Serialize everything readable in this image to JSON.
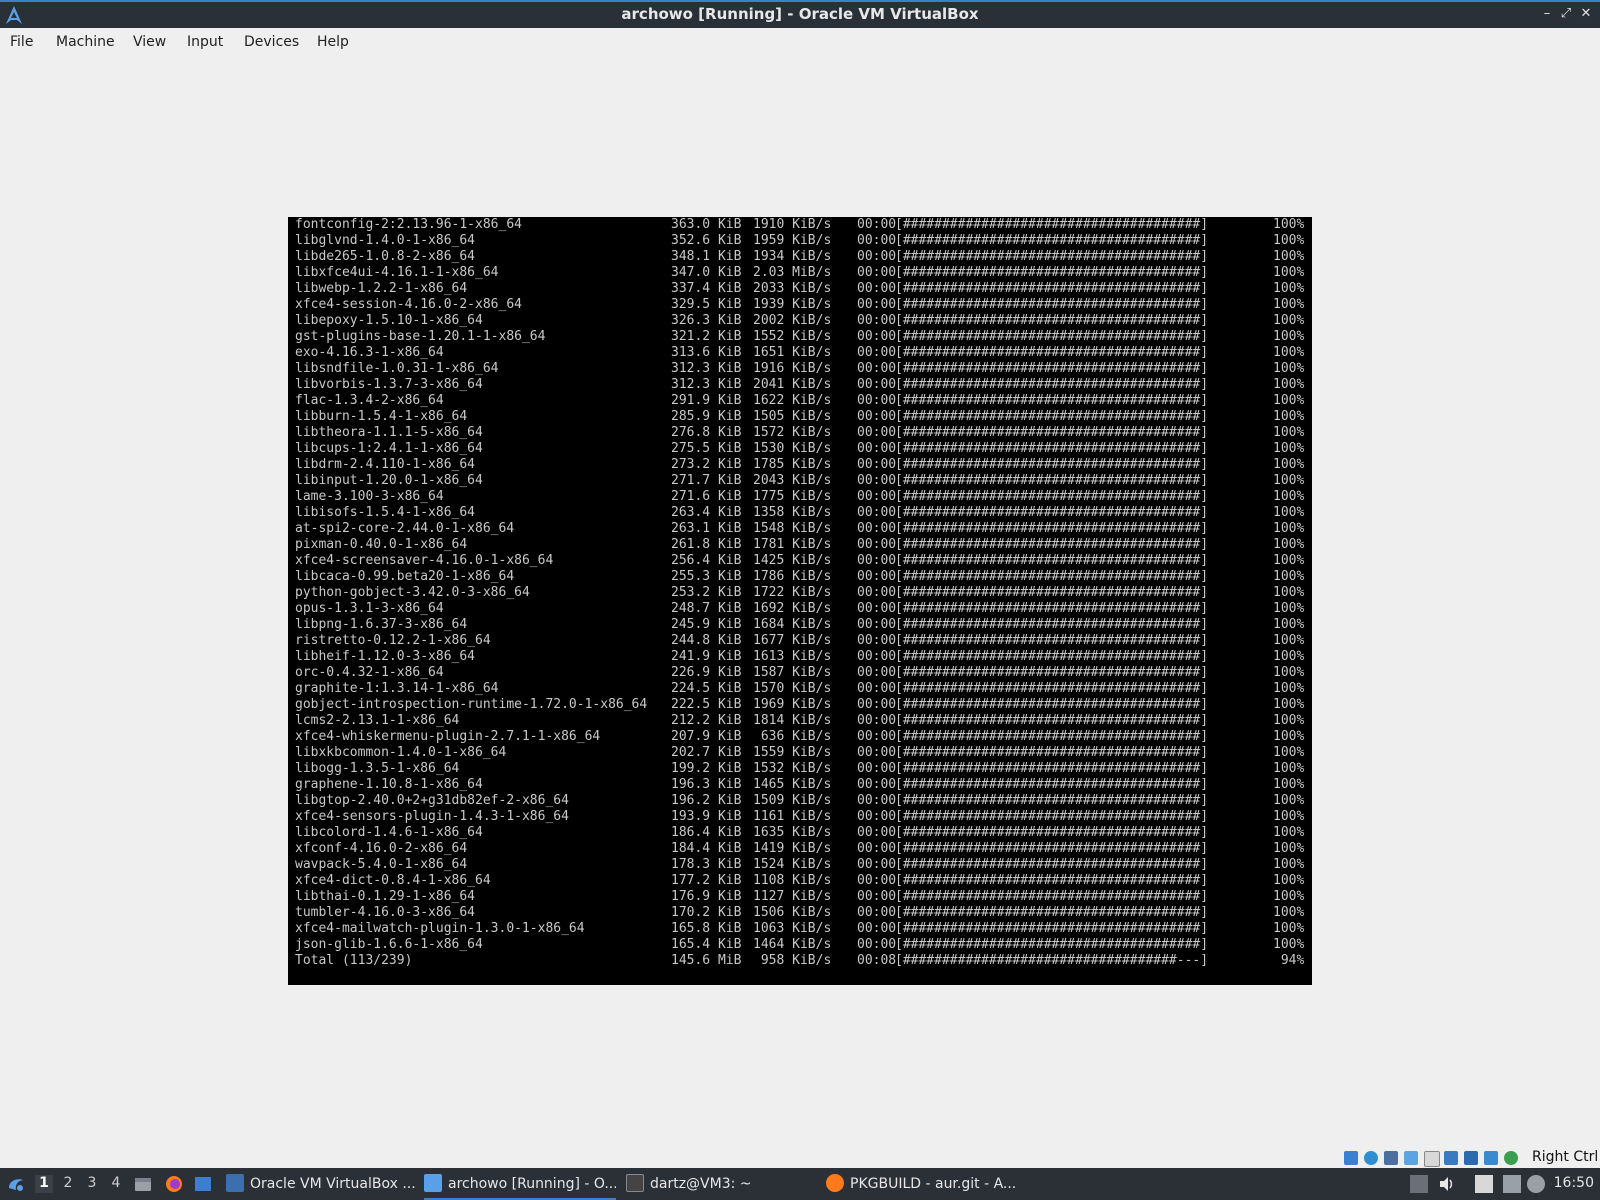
{
  "window": {
    "title": "archowo [Running] - Oracle VM VirtualBox",
    "controls": {
      "minimize": "–",
      "maximize": "⤢",
      "close": "✕"
    }
  },
  "menu": [
    "File",
    "Machine",
    "View",
    "Input",
    "Devices",
    "Help"
  ],
  "terminal": {
    "rows": [
      {
        "name": "fontconfig-2:2.13.96-1-x86_64",
        "size": "363.0 KiB",
        "rate": "1910 KiB/s",
        "time": "00:00",
        "bar": "[######################################]",
        "pct": "100%"
      },
      {
        "name": "libglvnd-1.4.0-1-x86_64",
        "size": "352.6 KiB",
        "rate": "1959 KiB/s",
        "time": "00:00",
        "bar": "[######################################]",
        "pct": "100%"
      },
      {
        "name": "libde265-1.0.8-2-x86_64",
        "size": "348.1 KiB",
        "rate": "1934 KiB/s",
        "time": "00:00",
        "bar": "[######################################]",
        "pct": "100%"
      },
      {
        "name": "libxfce4ui-4.16.1-1-x86_64",
        "size": "347.0 KiB",
        "rate": "2.03 MiB/s",
        "time": "00:00",
        "bar": "[######################################]",
        "pct": "100%"
      },
      {
        "name": "libwebp-1.2.2-1-x86_64",
        "size": "337.4 KiB",
        "rate": "2033 KiB/s",
        "time": "00:00",
        "bar": "[######################################]",
        "pct": "100%"
      },
      {
        "name": "xfce4-session-4.16.0-2-x86_64",
        "size": "329.5 KiB",
        "rate": "1939 KiB/s",
        "time": "00:00",
        "bar": "[######################################]",
        "pct": "100%"
      },
      {
        "name": "libepoxy-1.5.10-1-x86_64",
        "size": "326.3 KiB",
        "rate": "2002 KiB/s",
        "time": "00:00",
        "bar": "[######################################]",
        "pct": "100%"
      },
      {
        "name": "gst-plugins-base-1.20.1-1-x86_64",
        "size": "321.2 KiB",
        "rate": "1552 KiB/s",
        "time": "00:00",
        "bar": "[######################################]",
        "pct": "100%"
      },
      {
        "name": "exo-4.16.3-1-x86_64",
        "size": "313.6 KiB",
        "rate": "1651 KiB/s",
        "time": "00:00",
        "bar": "[######################################]",
        "pct": "100%"
      },
      {
        "name": "libsndfile-1.0.31-1-x86_64",
        "size": "312.3 KiB",
        "rate": "1916 KiB/s",
        "time": "00:00",
        "bar": "[######################################]",
        "pct": "100%"
      },
      {
        "name": "libvorbis-1.3.7-3-x86_64",
        "size": "312.3 KiB",
        "rate": "2041 KiB/s",
        "time": "00:00",
        "bar": "[######################################]",
        "pct": "100%"
      },
      {
        "name": "flac-1.3.4-2-x86_64",
        "size": "291.9 KiB",
        "rate": "1622 KiB/s",
        "time": "00:00",
        "bar": "[######################################]",
        "pct": "100%"
      },
      {
        "name": "libburn-1.5.4-1-x86_64",
        "size": "285.9 KiB",
        "rate": "1505 KiB/s",
        "time": "00:00",
        "bar": "[######################################]",
        "pct": "100%"
      },
      {
        "name": "libtheora-1.1.1-5-x86_64",
        "size": "276.8 KiB",
        "rate": "1572 KiB/s",
        "time": "00:00",
        "bar": "[######################################]",
        "pct": "100%"
      },
      {
        "name": "libcups-1:2.4.1-1-x86_64",
        "size": "275.5 KiB",
        "rate": "1530 KiB/s",
        "time": "00:00",
        "bar": "[######################################]",
        "pct": "100%"
      },
      {
        "name": "libdrm-2.4.110-1-x86_64",
        "size": "273.2 KiB",
        "rate": "1785 KiB/s",
        "time": "00:00",
        "bar": "[######################################]",
        "pct": "100%"
      },
      {
        "name": "libinput-1.20.0-1-x86_64",
        "size": "271.7 KiB",
        "rate": "2043 KiB/s",
        "time": "00:00",
        "bar": "[######################################]",
        "pct": "100%"
      },
      {
        "name": "lame-3.100-3-x86_64",
        "size": "271.6 KiB",
        "rate": "1775 KiB/s",
        "time": "00:00",
        "bar": "[######################################]",
        "pct": "100%"
      },
      {
        "name": "libisofs-1.5.4-1-x86_64",
        "size": "263.4 KiB",
        "rate": "1358 KiB/s",
        "time": "00:00",
        "bar": "[######################################]",
        "pct": "100%"
      },
      {
        "name": "at-spi2-core-2.44.0-1-x86_64",
        "size": "263.1 KiB",
        "rate": "1548 KiB/s",
        "time": "00:00",
        "bar": "[######################################]",
        "pct": "100%"
      },
      {
        "name": "pixman-0.40.0-1-x86_64",
        "size": "261.8 KiB",
        "rate": "1781 KiB/s",
        "time": "00:00",
        "bar": "[######################################]",
        "pct": "100%"
      },
      {
        "name": "xfce4-screensaver-4.16.0-1-x86_64",
        "size": "256.4 KiB",
        "rate": "1425 KiB/s",
        "time": "00:00",
        "bar": "[######################################]",
        "pct": "100%"
      },
      {
        "name": "libcaca-0.99.beta20-1-x86_64",
        "size": "255.3 KiB",
        "rate": "1786 KiB/s",
        "time": "00:00",
        "bar": "[######################################]",
        "pct": "100%"
      },
      {
        "name": "python-gobject-3.42.0-3-x86_64",
        "size": "253.2 KiB",
        "rate": "1722 KiB/s",
        "time": "00:00",
        "bar": "[######################################]",
        "pct": "100%"
      },
      {
        "name": "opus-1.3.1-3-x86_64",
        "size": "248.7 KiB",
        "rate": "1692 KiB/s",
        "time": "00:00",
        "bar": "[######################################]",
        "pct": "100%"
      },
      {
        "name": "libpng-1.6.37-3-x86_64",
        "size": "245.9 KiB",
        "rate": "1684 KiB/s",
        "time": "00:00",
        "bar": "[######################################]",
        "pct": "100%"
      },
      {
        "name": "ristretto-0.12.2-1-x86_64",
        "size": "244.8 KiB",
        "rate": "1677 KiB/s",
        "time": "00:00",
        "bar": "[######################################]",
        "pct": "100%"
      },
      {
        "name": "libheif-1.12.0-3-x86_64",
        "size": "241.9 KiB",
        "rate": "1613 KiB/s",
        "time": "00:00",
        "bar": "[######################################]",
        "pct": "100%"
      },
      {
        "name": "orc-0.4.32-1-x86_64",
        "size": "226.9 KiB",
        "rate": "1587 KiB/s",
        "time": "00:00",
        "bar": "[######################################]",
        "pct": "100%"
      },
      {
        "name": "graphite-1:1.3.14-1-x86_64",
        "size": "224.5 KiB",
        "rate": "1570 KiB/s",
        "time": "00:00",
        "bar": "[######################################]",
        "pct": "100%"
      },
      {
        "name": "gobject-introspection-runtime-1.72.0-1-x86_64",
        "size": "222.5 KiB",
        "rate": "1969 KiB/s",
        "time": "00:00",
        "bar": "[######################################]",
        "pct": "100%"
      },
      {
        "name": "lcms2-2.13.1-1-x86_64",
        "size": "212.2 KiB",
        "rate": "1814 KiB/s",
        "time": "00:00",
        "bar": "[######################################]",
        "pct": "100%"
      },
      {
        "name": "xfce4-whiskermenu-plugin-2.7.1-1-x86_64",
        "size": "207.9 KiB",
        "rate": " 636 KiB/s",
        "time": "00:00",
        "bar": "[######################################]",
        "pct": "100%"
      },
      {
        "name": "libxkbcommon-1.4.0-1-x86_64",
        "size": "202.7 KiB",
        "rate": "1559 KiB/s",
        "time": "00:00",
        "bar": "[######################################]",
        "pct": "100%"
      },
      {
        "name": "libogg-1.3.5-1-x86_64",
        "size": "199.2 KiB",
        "rate": "1532 KiB/s",
        "time": "00:00",
        "bar": "[######################################]",
        "pct": "100%"
      },
      {
        "name": "graphene-1.10.8-1-x86_64",
        "size": "196.3 KiB",
        "rate": "1465 KiB/s",
        "time": "00:00",
        "bar": "[######################################]",
        "pct": "100%"
      },
      {
        "name": "libgtop-2.40.0+2+g31db82ef-2-x86_64",
        "size": "196.2 KiB",
        "rate": "1509 KiB/s",
        "time": "00:00",
        "bar": "[######################################]",
        "pct": "100%"
      },
      {
        "name": "xfce4-sensors-plugin-1.4.3-1-x86_64",
        "size": "193.9 KiB",
        "rate": "1161 KiB/s",
        "time": "00:00",
        "bar": "[######################################]",
        "pct": "100%"
      },
      {
        "name": "libcolord-1.4.6-1-x86_64",
        "size": "186.4 KiB",
        "rate": "1635 KiB/s",
        "time": "00:00",
        "bar": "[######################################]",
        "pct": "100%"
      },
      {
        "name": "xfconf-4.16.0-2-x86_64",
        "size": "184.4 KiB",
        "rate": "1419 KiB/s",
        "time": "00:00",
        "bar": "[######################################]",
        "pct": "100%"
      },
      {
        "name": "wavpack-5.4.0-1-x86_64",
        "size": "178.3 KiB",
        "rate": "1524 KiB/s",
        "time": "00:00",
        "bar": "[######################################]",
        "pct": "100%"
      },
      {
        "name": "xfce4-dict-0.8.4-1-x86_64",
        "size": "177.2 KiB",
        "rate": "1108 KiB/s",
        "time": "00:00",
        "bar": "[######################################]",
        "pct": "100%"
      },
      {
        "name": "libthai-0.1.29-1-x86_64",
        "size": "176.9 KiB",
        "rate": "1127 KiB/s",
        "time": "00:00",
        "bar": "[######################################]",
        "pct": "100%"
      },
      {
        "name": "tumbler-4.16.0-3-x86_64",
        "size": "170.2 KiB",
        "rate": "1506 KiB/s",
        "time": "00:00",
        "bar": "[######################################]",
        "pct": "100%"
      },
      {
        "name": "xfce4-mailwatch-plugin-1.3.0-1-x86_64",
        "size": "165.8 KiB",
        "rate": "1063 KiB/s",
        "time": "00:00",
        "bar": "[######################################]",
        "pct": "100%"
      },
      {
        "name": "json-glib-1.6.6-1-x86_64",
        "size": "165.4 KiB",
        "rate": "1464 KiB/s",
        "time": "00:00",
        "bar": "[######################################]",
        "pct": "100%"
      },
      {
        "name": "Total (113/239)",
        "size": "145.6 MiB",
        "rate": " 958 KiB/s",
        "time": "00:08",
        "bar": "[###################################---]",
        "pct": " 94%"
      }
    ]
  },
  "statusbar": {
    "icons": [
      "hard-disk-icon",
      "optical-disk-icon",
      "network-icon",
      "usb-icon",
      "shared-folder-icon",
      "display-icon",
      "video-capture-icon",
      "recording-icon",
      "mouse-integration-icon",
      "cpu-icon"
    ],
    "host_key": "Right Ctrl"
  },
  "taskbar": {
    "workspaces": [
      "1",
      "2",
      "3",
      "4"
    ],
    "active_workspace": "1",
    "tasks": [
      {
        "label": "Oracle VM VirtualBox ...",
        "icon": "virtualbox-icon"
      },
      {
        "label": "archowo [Running] - O...",
        "icon": "arch-icon",
        "active": true
      },
      {
        "label": "dartz@VM3: ~",
        "icon": "terminal-icon"
      },
      {
        "label": "PKGBUILD - aur.git - A...",
        "icon": "firefox-icon"
      }
    ],
    "clock": "16:50"
  },
  "colors": {
    "accent": "#3c7fd1",
    "taskbar_bg": "#2b2f36",
    "terminal_bg": "#000000",
    "terminal_fg": "#c8c8c8"
  }
}
